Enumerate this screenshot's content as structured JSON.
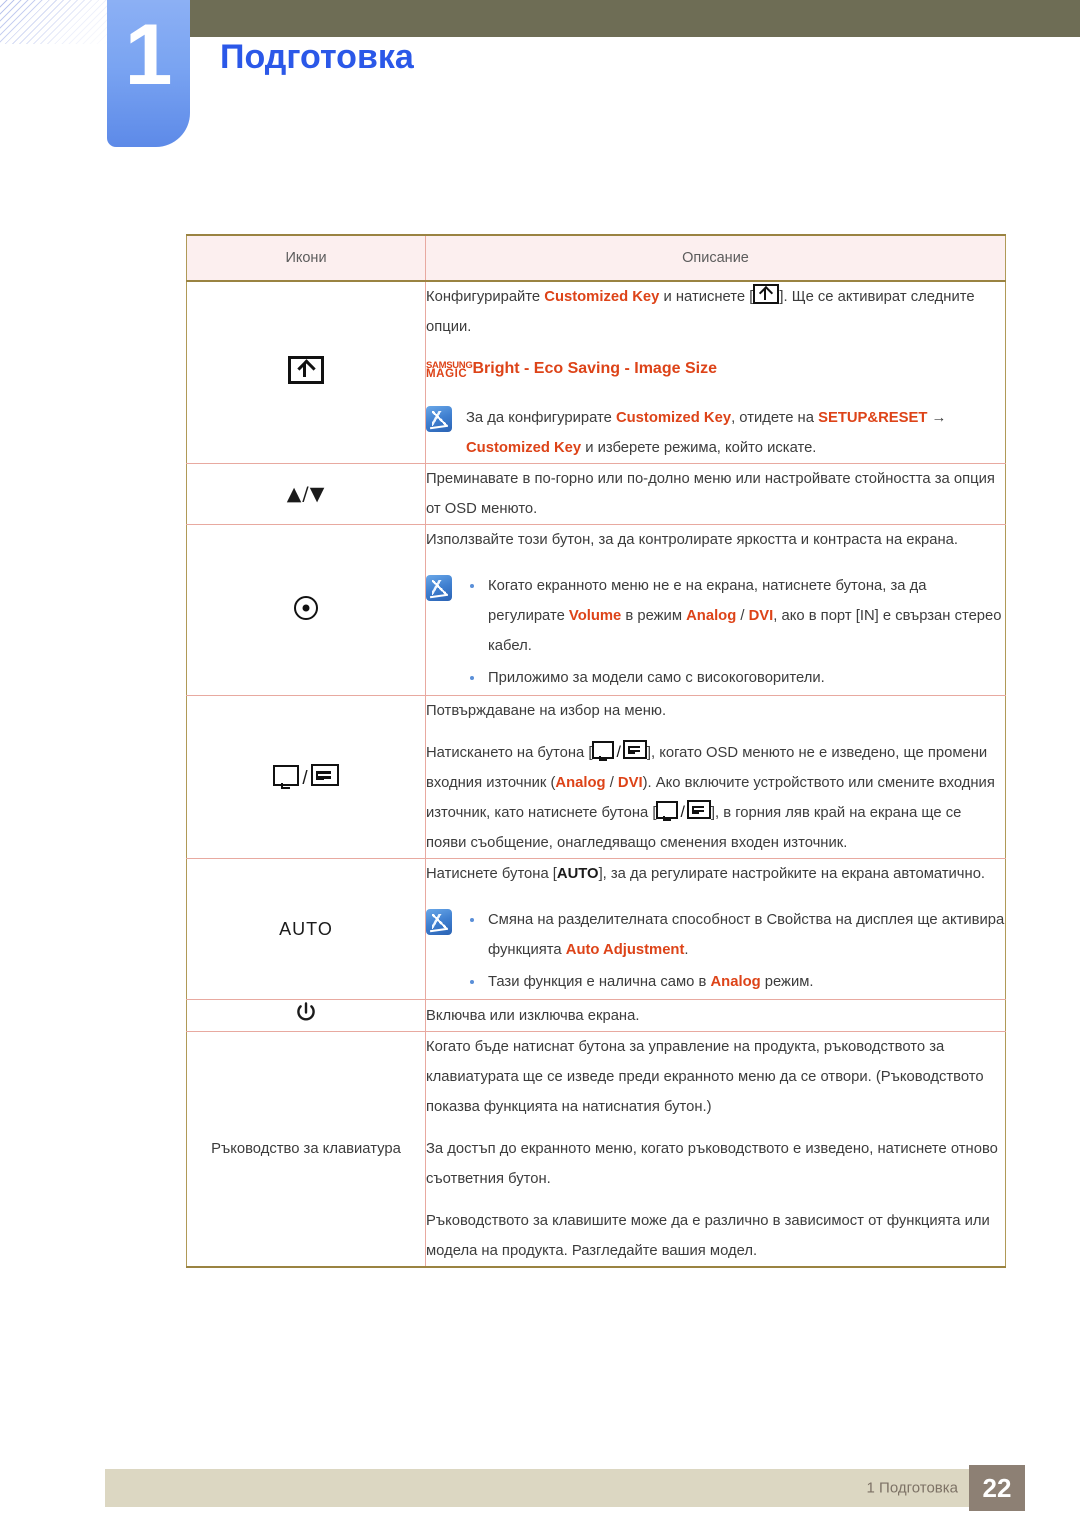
{
  "header": {
    "chapter_number": "1",
    "title": "Подготовка",
    "accent_color": "#2b58e8",
    "tab_color": "#7aa4f2",
    "bar_color": "#6e6d55"
  },
  "table": {
    "columns": [
      "Икони",
      "Описание"
    ],
    "rows": [
      {
        "icon_name": "customized-key-icon",
        "icon_label": "",
        "blocks": [
          {
            "type": "paragraph",
            "parts": [
              {
                "t": "Конфигурирайте ",
                "s": "plain"
              },
              {
                "t": "Customized Key",
                "s": "hl"
              },
              {
                "t": " и натиснете [",
                "s": "plain"
              },
              {
                "t": "",
                "s": "icon-custkey"
              },
              {
                "t": "]. Ще се активират следните опции.",
                "s": "plain"
              }
            ]
          },
          {
            "type": "magic",
            "logo_line1": "SAMSUNG",
            "logo_line2": "MAGIC",
            "rest": "Bright - Eco Saving - Image Size"
          },
          {
            "type": "note",
            "icon_name": "note-pen-icon",
            "items": [
              {
                "bullet": false,
                "parts": [
                  {
                    "t": "За да конфигурирате ",
                    "s": "plain"
                  },
                  {
                    "t": "Customized Key",
                    "s": "hl"
                  },
                  {
                    "t": ", отидете на ",
                    "s": "plain"
                  },
                  {
                    "t": "SETUP&RESET",
                    "s": "hl"
                  },
                  {
                    "t": "  →  ",
                    "s": "plain"
                  },
                  {
                    "t": "Customized Key",
                    "s": "hl"
                  },
                  {
                    "t": " и изберете режима, който искате.",
                    "s": "plain"
                  }
                ]
              }
            ]
          }
        ]
      },
      {
        "icon_name": "up-down-arrows-icon",
        "icon_label": "▲/▼",
        "blocks": [
          {
            "type": "paragraph",
            "parts": [
              {
                "t": "Преминавате в по-горно или по-долно меню или настройвате стойността за опция от OSD менюто.",
                "s": "plain"
              }
            ]
          }
        ]
      },
      {
        "icon_name": "brightness-contrast-icon",
        "icon_label": "",
        "blocks": [
          {
            "type": "paragraph",
            "parts": [
              {
                "t": "Използвайте този бутон, за да контролирате яркостта и контраста на екрана.",
                "s": "plain"
              }
            ]
          },
          {
            "type": "note",
            "icon_name": "note-pen-icon",
            "items": [
              {
                "bullet": true,
                "parts": [
                  {
                    "t": "Когато екранното меню не е на екрана, натиснете бутона, за да регулирате ",
                    "s": "plain"
                  },
                  {
                    "t": "Volume",
                    "s": "hl"
                  },
                  {
                    "t": " в режим ",
                    "s": "plain"
                  },
                  {
                    "t": "Analog",
                    "s": "hl"
                  },
                  {
                    "t": " / ",
                    "s": "plain"
                  },
                  {
                    "t": "DVI",
                    "s": "hl"
                  },
                  {
                    "t": ", ако в порт [IN] е свързан стерео кабел.",
                    "s": "plain"
                  }
                ]
              },
              {
                "bullet": true,
                "parts": [
                  {
                    "t": "Приложимо за модели само с високоговорители.",
                    "s": "plain"
                  }
                ]
              }
            ]
          }
        ]
      },
      {
        "icon_name": "source-enter-icon",
        "icon_label": "",
        "blocks": [
          {
            "type": "paragraph",
            "parts": [
              {
                "t": "Потвърждаване на избор на меню.",
                "s": "plain"
              }
            ]
          },
          {
            "type": "paragraph",
            "parts": [
              {
                "t": "Натискането на бутона [",
                "s": "plain"
              },
              {
                "t": "",
                "s": "icon-srcenter"
              },
              {
                "t": "], когато OSD менюто не е изведено, ще промени входния източник (",
                "s": "plain"
              },
              {
                "t": "Analog",
                "s": "hl"
              },
              {
                "t": " / ",
                "s": "plain"
              },
              {
                "t": "DVI",
                "s": "hl"
              },
              {
                "t": "). Ако включите устройството или смените входния източник, като натиснете бутона [",
                "s": "plain"
              },
              {
                "t": "",
                "s": "icon-srcenter"
              },
              {
                "t": "], в горния ляв край на екрана ще се появи съобщение, онагледяващо сменения входен източник.",
                "s": "plain"
              }
            ]
          }
        ]
      },
      {
        "icon_name": "auto-button-icon",
        "icon_label": "AUTO",
        "blocks": [
          {
            "type": "paragraph",
            "parts": [
              {
                "t": "Натиснете бутона [",
                "s": "plain"
              },
              {
                "t": "AUTO",
                "s": "bold"
              },
              {
                "t": "], за да регулирате настройките на екрана автоматично.",
                "s": "plain"
              }
            ]
          },
          {
            "type": "note",
            "icon_name": "note-pen-icon",
            "items": [
              {
                "bullet": true,
                "parts": [
                  {
                    "t": "Смяна на разделителната способност в Свойства на дисплея ще активира функцията ",
                    "s": "plain"
                  },
                  {
                    "t": "Auto Adjustment",
                    "s": "hl"
                  },
                  {
                    "t": ".",
                    "s": "plain"
                  }
                ]
              },
              {
                "bullet": true,
                "parts": [
                  {
                    "t": "Тази функция е налична само в ",
                    "s": "plain"
                  },
                  {
                    "t": "Analog",
                    "s": "hl"
                  },
                  {
                    "t": " режим.",
                    "s": "plain"
                  }
                ]
              }
            ]
          }
        ]
      },
      {
        "icon_name": "power-icon",
        "icon_label": "",
        "blocks": [
          {
            "type": "paragraph",
            "parts": [
              {
                "t": "Включва или изключва екрана.",
                "s": "plain"
              }
            ]
          }
        ]
      },
      {
        "icon_name": "keyboard-guide-label",
        "icon_label": "Ръководство за клавиатура",
        "blocks": [
          {
            "type": "paragraph",
            "parts": [
              {
                "t": "Когато бъде натиснат бутона за управление на продукта, ръководството за клавиатурата ще се изведе преди екранното меню да се отвори. (Ръководството показва функцията на натиснатия бутон.)",
                "s": "plain"
              }
            ]
          },
          {
            "type": "paragraph",
            "parts": [
              {
                "t": "За достъп до екранното меню, когато ръководството е изведено, натиснете отново съответния бутон.",
                "s": "plain"
              }
            ]
          },
          {
            "type": "paragraph",
            "parts": [
              {
                "t": "Ръководството за клавишите може да е различно в зависимост от функцията или модела на продукта. Разгледайте вашия модел.",
                "s": "plain"
              }
            ]
          }
        ]
      }
    ]
  },
  "footer": {
    "label": "1 Подготовка",
    "page": "22",
    "bar_color": "#dcd7c2",
    "page_box_color": "#8d8074"
  }
}
